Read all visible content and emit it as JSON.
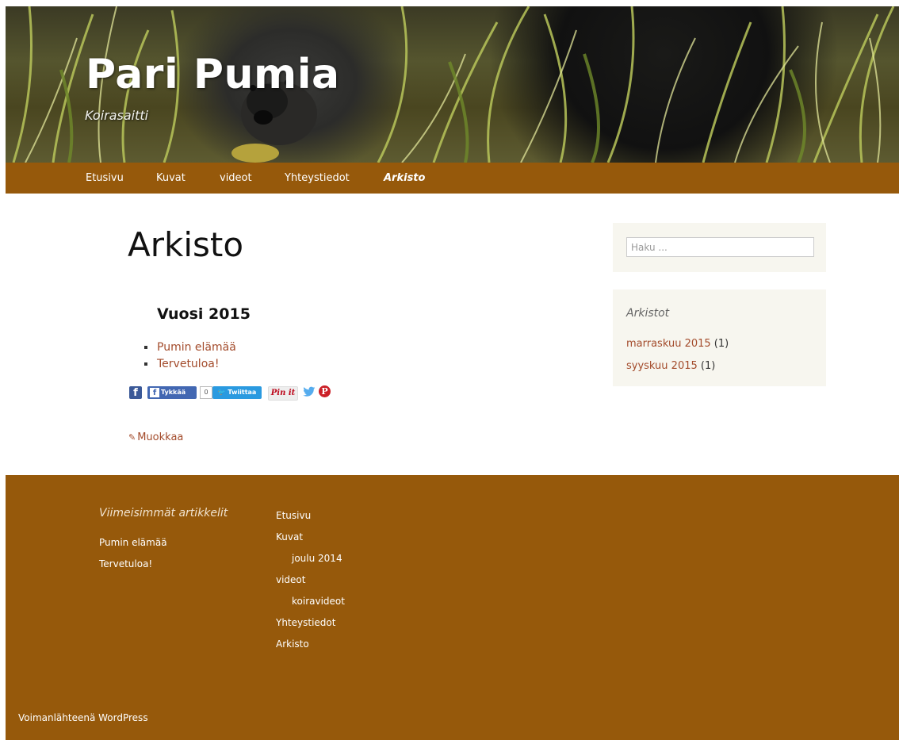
{
  "site": {
    "title": "Pari Pumia",
    "tagline": "Koirasaitti"
  },
  "nav": {
    "items": [
      {
        "label": "Etusivu"
      },
      {
        "label": "Kuvat"
      },
      {
        "label": "videot"
      },
      {
        "label": "Yhteystiedot"
      },
      {
        "label": "Arkisto",
        "current": true
      }
    ]
  },
  "main": {
    "page_title": "Arkisto",
    "year_heading": "Vuosi 2015",
    "posts": [
      "Pumin elämää",
      "Tervetuloa!"
    ],
    "share": {
      "fb_icon": "f",
      "fb_like_label": "Tykkää",
      "like_count": "0",
      "tweet_label": "Twiittaa",
      "pin_label": "Pin it",
      "pin_icon": "P"
    },
    "edit_label": "Muokkaa"
  },
  "sidebar": {
    "search": {
      "placeholder": "Haku ..."
    },
    "archives": {
      "title": "Arkistot",
      "items": [
        {
          "label": "marraskuu 2015",
          "count": "(1)"
        },
        {
          "label": "syyskuu 2015",
          "count": "(1)"
        }
      ]
    }
  },
  "footer": {
    "recent_title": "Viimeisimmät artikkelit",
    "recent_posts": [
      "Pumin elämää",
      "Tervetuloa!"
    ],
    "menu": [
      {
        "label": "Etusivu",
        "level": 0
      },
      {
        "label": "Kuvat",
        "level": 0
      },
      {
        "label": "joulu 2014",
        "level": 1
      },
      {
        "label": "videot",
        "level": 0
      },
      {
        "label": "koiravideot",
        "level": 1
      },
      {
        "label": "Yhteystiedot",
        "level": 0
      },
      {
        "label": "Arkisto",
        "level": 0
      }
    ],
    "powered_by": "Voimanlähteenä WordPress"
  },
  "colors": {
    "brand_brown": "#96590b",
    "link": "#a34b2b",
    "widget_bg": "#f7f6ef"
  }
}
